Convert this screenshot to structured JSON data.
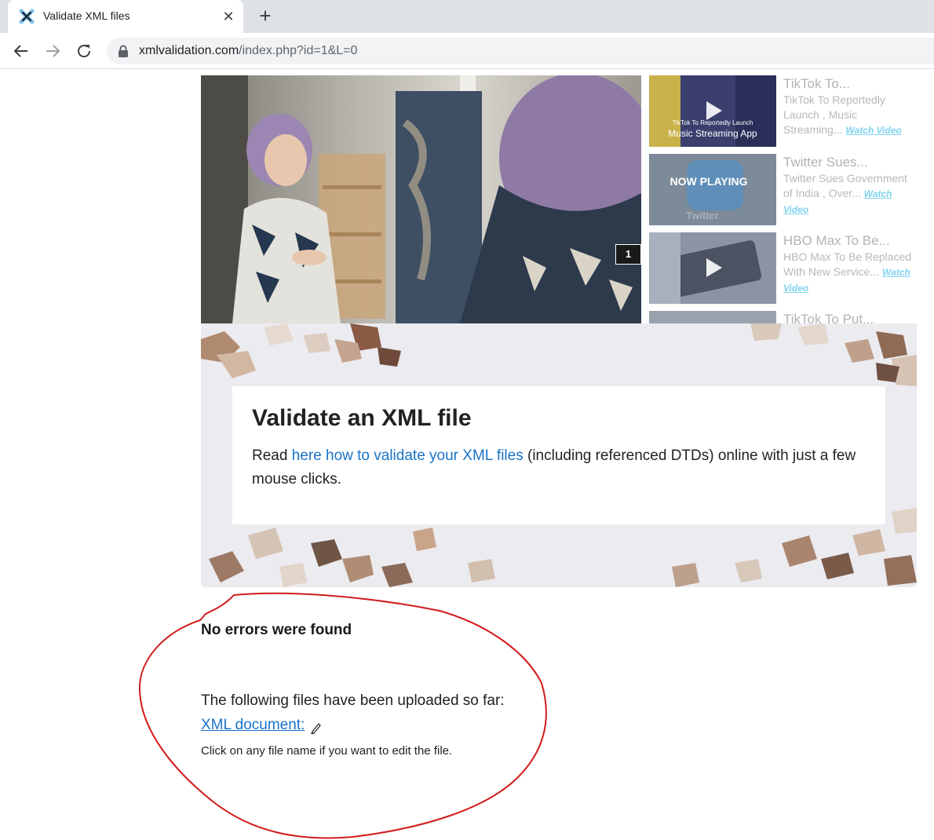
{
  "browser": {
    "tab_title": "Validate XML files",
    "tab_close_glyph": "✕",
    "new_tab_glyph": "+",
    "url_host": "xmlvalidation.com",
    "url_path": "/index.php?id=1&L=0",
    "icons": [
      "back-arrow-icon",
      "forward-arrow-icon",
      "reload-icon",
      "lock-icon"
    ]
  },
  "video": {
    "slide_counter": "1",
    "playlist": [
      {
        "title": "TikTok To...",
        "description": "TikTok To Reportedly Launch , Music Streaming...",
        "watch_label": "Watch Video",
        "thumb_caption_small": "TikTok To Reportedly Launch",
        "thumb_caption": "Music Streaming App"
      },
      {
        "title": "Twitter Sues...",
        "description": "Twitter Sues Government of India , Over...",
        "watch_label": "Watch Video",
        "thumb_caption_small": "Twitter",
        "thumb_caption": "NOW PLAYING"
      },
      {
        "title": "HBO Max To Be...",
        "description": "HBO Max To Be Replaced  With New Service...",
        "watch_label": "Watch Video"
      },
      {
        "title": "TikTok To Put..."
      }
    ]
  },
  "hero": {
    "title": "Validate an XML file",
    "text_before": "Read ",
    "link_text": "here how to validate your XML files",
    "text_after": " (including referenced DTDs) online with just a few mouse clicks."
  },
  "result": {
    "heading": "No errors were found",
    "uploaded_text": "The following files have been uploaded so far:",
    "file_link": "XML document:",
    "hint": "Click on any file name if you want to edit the file."
  },
  "colors": {
    "link": "#1a73c8",
    "annotation": "#d11a1a",
    "watch_link": "#7fd3ee"
  }
}
